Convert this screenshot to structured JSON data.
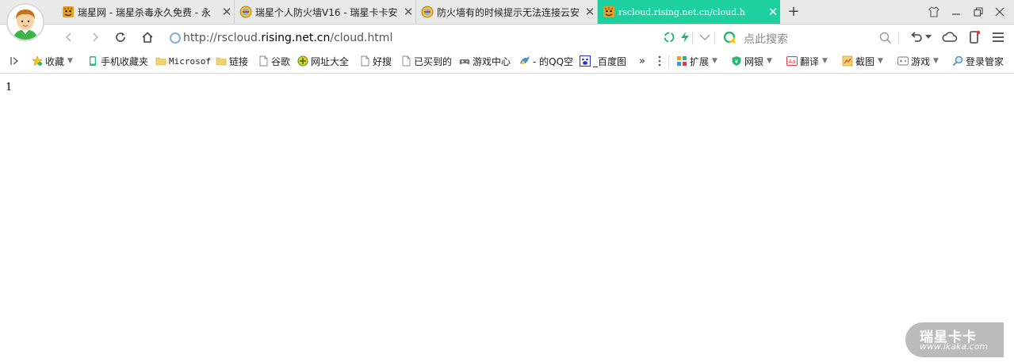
{
  "tabs": [
    {
      "title": "瑞星网 - 瑞星杀毒永久免费 - 永",
      "icon": "tiger-icon",
      "active": false
    },
    {
      "title": "瑞星个人防火墙V16 - 瑞星卡卡安",
      "icon": "firewall-icon",
      "active": false
    },
    {
      "title": "防火墙有的时候提示无法连接云安",
      "icon": "firewall-icon",
      "active": false
    },
    {
      "title": "rscloud.rising.net.cn/cloud.h",
      "icon": "tiger-icon",
      "active": true
    }
  ],
  "address": {
    "prefix": "http://rscloud.",
    "domain": "rising.net.cn",
    "suffix": "/cloud.html"
  },
  "search": {
    "placeholder": "点此搜索"
  },
  "bookmarks": [
    {
      "label": "收藏",
      "icon": "star-icon",
      "dropdown": true
    },
    {
      "label": "手机收藏夹",
      "icon": "phone-icon"
    },
    {
      "label": "Microsof",
      "icon": "folder-icon"
    },
    {
      "label": "链接",
      "icon": "folder-icon"
    },
    {
      "label": "谷歌",
      "icon": "page-icon"
    },
    {
      "label": "网址大全",
      "icon": "globe-icon"
    },
    {
      "label": "好搜",
      "icon": "page-icon"
    },
    {
      "label": "已买到的",
      "icon": "page-icon"
    },
    {
      "label": "游戏中心",
      "icon": "gamepad-icon"
    },
    {
      "label": "- 的QQ空",
      "icon": "qq-icon"
    },
    {
      "label": "_百度图",
      "icon": "baidu-icon"
    }
  ],
  "bookmarks_more": "»",
  "tools": [
    {
      "label": "扩展",
      "icon": "extension-icon"
    },
    {
      "label": "网银",
      "icon": "bank-icon"
    },
    {
      "label": "翻译",
      "icon": "translate-icon"
    },
    {
      "label": "截图",
      "icon": "screenshot-icon"
    },
    {
      "label": "游戏",
      "icon": "game-icon"
    }
  ],
  "login": {
    "label": "登录管家",
    "icon": "login-icon"
  },
  "page": {
    "text": "1"
  },
  "watermark": {
    "line1": "瑞星卡卡",
    "line2": "www.ikaka.com"
  }
}
